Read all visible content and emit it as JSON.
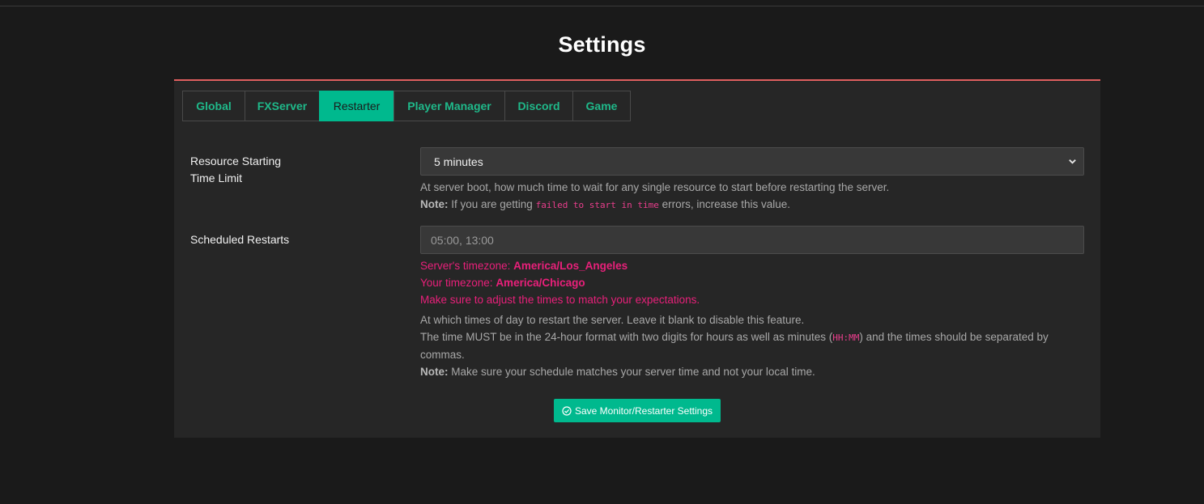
{
  "page": {
    "title": "Settings"
  },
  "tabs": [
    {
      "label": "Global",
      "active": false
    },
    {
      "label": "FXServer",
      "active": false
    },
    {
      "label": "Restarter",
      "active": true
    },
    {
      "label": "Player Manager",
      "active": false
    },
    {
      "label": "Discord",
      "active": false
    },
    {
      "label": "Game",
      "active": false
    }
  ],
  "resource_limit": {
    "label_line1": "Resource Starting",
    "label_line2": "Time Limit",
    "selected": "5 minutes",
    "help_text": "At server boot, how much time to wait for any single resource to start before restarting the server.",
    "note_label": "Note:",
    "note_pre": " If you are getting ",
    "note_code": "failed to start in time",
    "note_post": " errors, increase this value."
  },
  "scheduled_restarts": {
    "label": "Scheduled Restarts",
    "placeholder": "05:00, 13:00",
    "server_tz_label": "Server's timezone: ",
    "server_tz": "America/Los_Angeles",
    "your_tz_label": "Your timezone: ",
    "your_tz": "America/Chicago",
    "adjust_warning": "Make sure to adjust the times to match your expectations.",
    "help_line1": "At which times of day to restart the server. Leave it blank to disable this feature.",
    "help_line2_pre": "The time MUST be in the 24-hour format with two digits for hours as well as minutes (",
    "help_line2_code": "HH:MM",
    "help_line2_post": ") and the times should be separated by",
    "help_line3": "commas.",
    "note_label": "Note:",
    "note_text": " Make sure your schedule matches your server time and not your local time."
  },
  "save_button": {
    "label": "Save Monitor/Restarter Settings",
    "icon": "check-circle-icon"
  },
  "colors": {
    "accent": "#00b98e",
    "card_border": "#e05f5f",
    "warning": "#e8207a"
  }
}
